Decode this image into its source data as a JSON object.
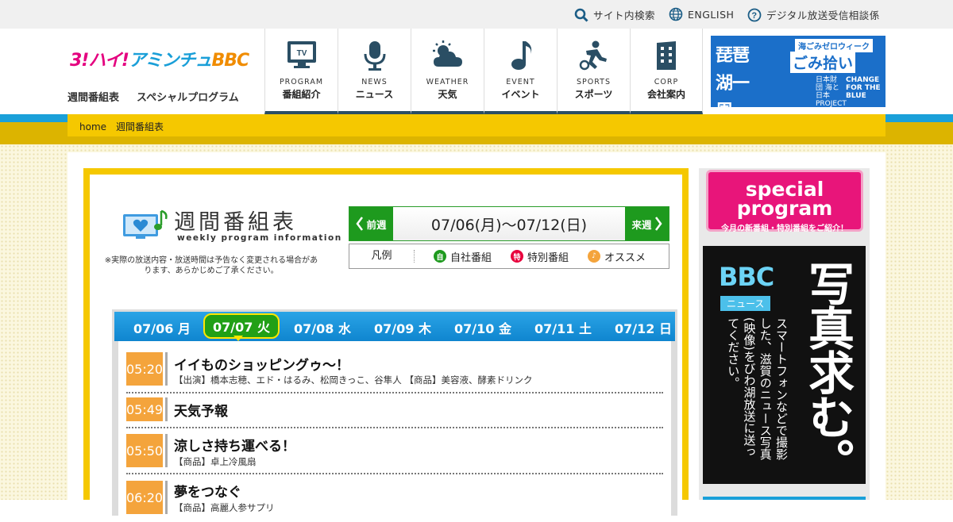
{
  "topbar": {
    "search": "サイト内検索",
    "english": "ENGLISH",
    "consult": "デジタル放送受信相談係"
  },
  "logo": {
    "text1": "3!ハイ!",
    "text2": "アミンチュ",
    "text3": "BBC"
  },
  "sublinks": {
    "weekly": "週間番組表",
    "special": "スペシャルプログラム"
  },
  "nav": [
    {
      "en": "PROGRAM",
      "jp": "番組紹介",
      "icon": "tv-icon"
    },
    {
      "en": "NEWS",
      "jp": "ニュース",
      "icon": "microphone-icon"
    },
    {
      "en": "WEATHER",
      "jp": "天気",
      "icon": "weather-icon"
    },
    {
      "en": "EVENT",
      "jp": "イベント",
      "icon": "music-note-icon"
    },
    {
      "en": "SPORTS",
      "jp": "スポーツ",
      "icon": "sports-icon"
    },
    {
      "en": "CORP",
      "jp": "会社案内",
      "icon": "building-icon"
    }
  ],
  "lake_banner": {
    "big": "琵琶湖一周",
    "tag": "海ごみゼロウィーク",
    "gomi": "ごみ拾い",
    "umi": "日本財団 海と日本 PROJECT",
    "change": "CHANGE FOR THE BLUE"
  },
  "breadcrumb": {
    "home": "home",
    "current": "週間番組表"
  },
  "weekly": {
    "title_jp": "週間番組表",
    "title_en": "weekly program information",
    "note": "※実際の放送内容・放送時間は予告なく変更される場合があります、あらかじめご了承ください。",
    "prev": "前週",
    "next": "来週",
    "range": "07/06(月)～07/12(日)"
  },
  "legend": {
    "label": "凡例",
    "own": "自社番組",
    "own_mark": "自",
    "special": "特別番組",
    "special_mark": "特",
    "recommend": "オススメ"
  },
  "tabs": [
    "07/06 月",
    "07/07 火",
    "07/08 水",
    "07/09 木",
    "07/10 金",
    "07/11 土",
    "07/12 日"
  ],
  "active_tab": 1,
  "programs": [
    {
      "time": "05:20",
      "title": "イイものショッピングゥ～！",
      "info": "【出演】橋本志穂、エド・はるみ、松岡きっこ、谷隼人 【商品】美容液、酵素ドリンク"
    },
    {
      "time": "05:49",
      "title": "天気予報",
      "info": ""
    },
    {
      "time": "05:50",
      "title": "涼しさ持ち運べる！",
      "info": "【商品】卓上冷風扇"
    },
    {
      "time": "06:20",
      "title": "夢をつなぐ",
      "info": "【商品】高麗人参サプリ"
    }
  ],
  "sidebar": {
    "special_title": "special program",
    "special_sub": "今月の新番組・特別番組をご紹介！",
    "photo_bbc": "BBC",
    "photo_news": "ニュース",
    "photo_big": "写真求む。",
    "photo_small": "スマートフォンなどで撮影した、滋賀のニュース写真(映像)をびわ湖放送に送ってください。"
  },
  "colors": {
    "accent_blue": "#1aa0d9",
    "gold": "#f5c800",
    "green": "#1e9a1e",
    "time_orange": "#f4a43c"
  }
}
